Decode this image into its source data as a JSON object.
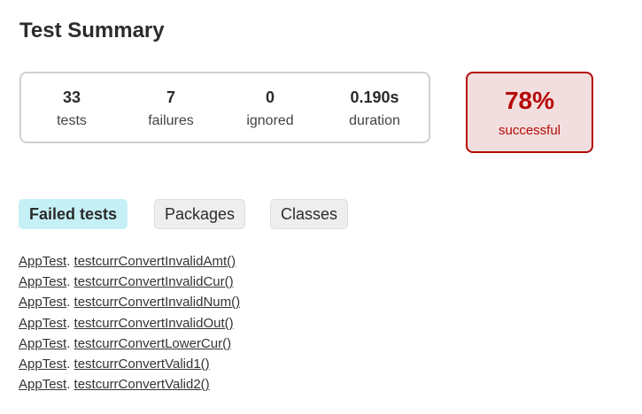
{
  "header": {
    "title": "Test Summary"
  },
  "summary": {
    "tests": {
      "value": "33",
      "label": "tests"
    },
    "failures": {
      "value": "7",
      "label": "failures"
    },
    "ignored": {
      "value": "0",
      "label": "ignored"
    },
    "duration": {
      "value": "0.190s",
      "label": "duration"
    }
  },
  "success": {
    "value": "78%",
    "label": "successful",
    "status_color": "#b60808",
    "background_color": "#f2dede"
  },
  "tabs": [
    {
      "label": "Failed tests",
      "selected": true
    },
    {
      "label": "Packages",
      "selected": false
    },
    {
      "label": "Classes",
      "selected": false
    }
  ],
  "failed_tests": [
    {
      "class": "AppTest",
      "separator": ".",
      "method": "testcurrConvertInvalidAmt()"
    },
    {
      "class": "AppTest",
      "separator": ".",
      "method": "testcurrConvertInvalidCur()"
    },
    {
      "class": "AppTest",
      "separator": ".",
      "method": "testcurrConvertInvalidNum()"
    },
    {
      "class": "AppTest",
      "separator": ".",
      "method": "testcurrConvertInvalidOut()"
    },
    {
      "class": "AppTest",
      "separator": ".",
      "method": "testcurrConvertLowerCur()"
    },
    {
      "class": "AppTest",
      "separator": ".",
      "method": "testcurrConvertValid1()"
    },
    {
      "class": "AppTest",
      "separator": ".",
      "method": "testcurrConvertValid2()"
    }
  ]
}
